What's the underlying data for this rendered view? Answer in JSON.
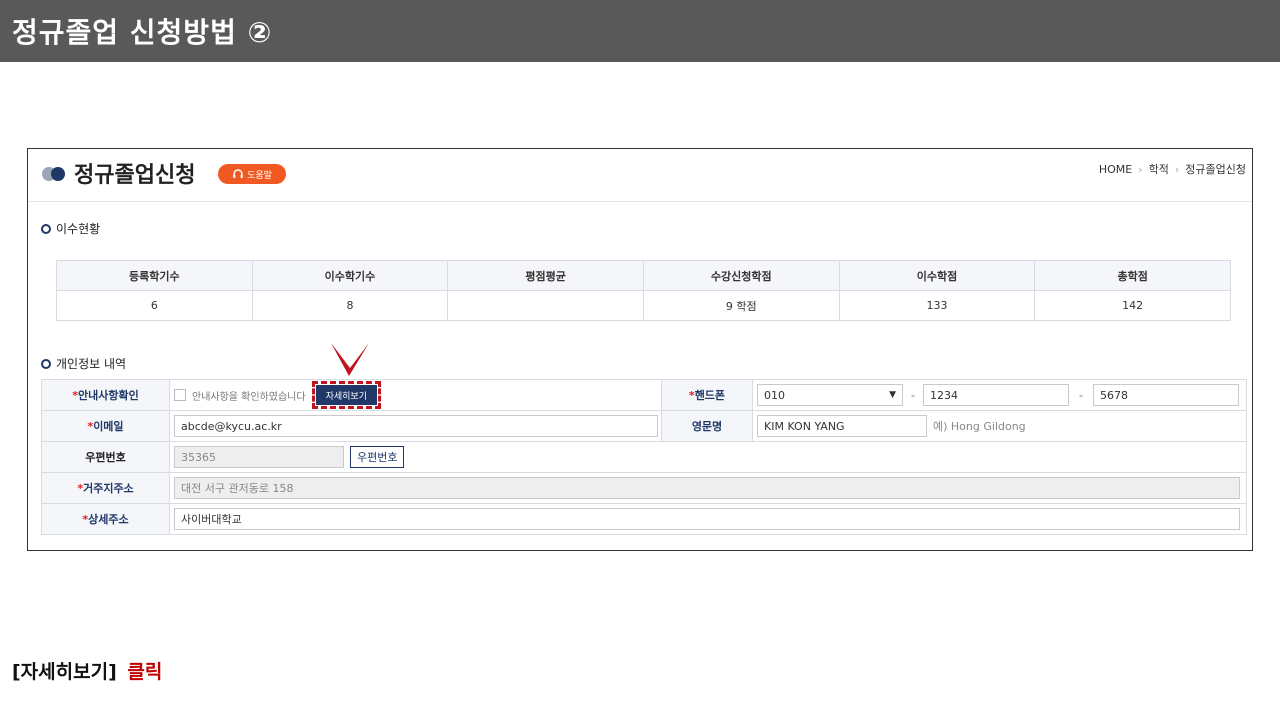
{
  "slide": {
    "title": "정규졸업 신청방법 ②",
    "caption_button": "[자세히보기]",
    "caption_action": "클릭",
    "header_color": "#595959",
    "caption_accent_color": "#c00000"
  },
  "page": {
    "title": "정규졸업신청",
    "help_label": "도움말",
    "breadcrumb": [
      "HOME",
      "학적",
      "정규졸업신청"
    ]
  },
  "completion": {
    "section_title": "이수현황",
    "headers": [
      "등록학기수",
      "이수학기수",
      "평점평균",
      "수강신청학점",
      "이수학점",
      "총학점"
    ],
    "values": [
      "6",
      "8",
      "",
      "9 학점",
      "133",
      "142"
    ]
  },
  "personal": {
    "section_title": "개인정보 내역",
    "notice_label": "안내사항확인",
    "notice_text": "안내사항을 확인하였습니다",
    "detail_button": "자세히보기",
    "phone_label": "핸드폰",
    "phone_prefix": "010",
    "phone_mid": "1234",
    "phone_last": "5678",
    "email_label": "이메일",
    "email_value": "abcde@kycu.ac.kr",
    "english_name_label": "영문명",
    "english_name_value": "KIM KON YANG",
    "english_name_hint": "예) Hong Gildong",
    "zip_label": "우편번호",
    "zip_value": "35365",
    "zip_button": "우편번호",
    "address_label": "거주지주소",
    "address_value": "대전 서구 관저동로 158",
    "detail_address_label": "상세주소",
    "detail_address_value": "사이버대학교",
    "required_mark": "*"
  },
  "colors": {
    "primary": "#1f3868",
    "help_badge": "#f05a22",
    "required": "#e02020",
    "highlight": "#c0141e"
  }
}
